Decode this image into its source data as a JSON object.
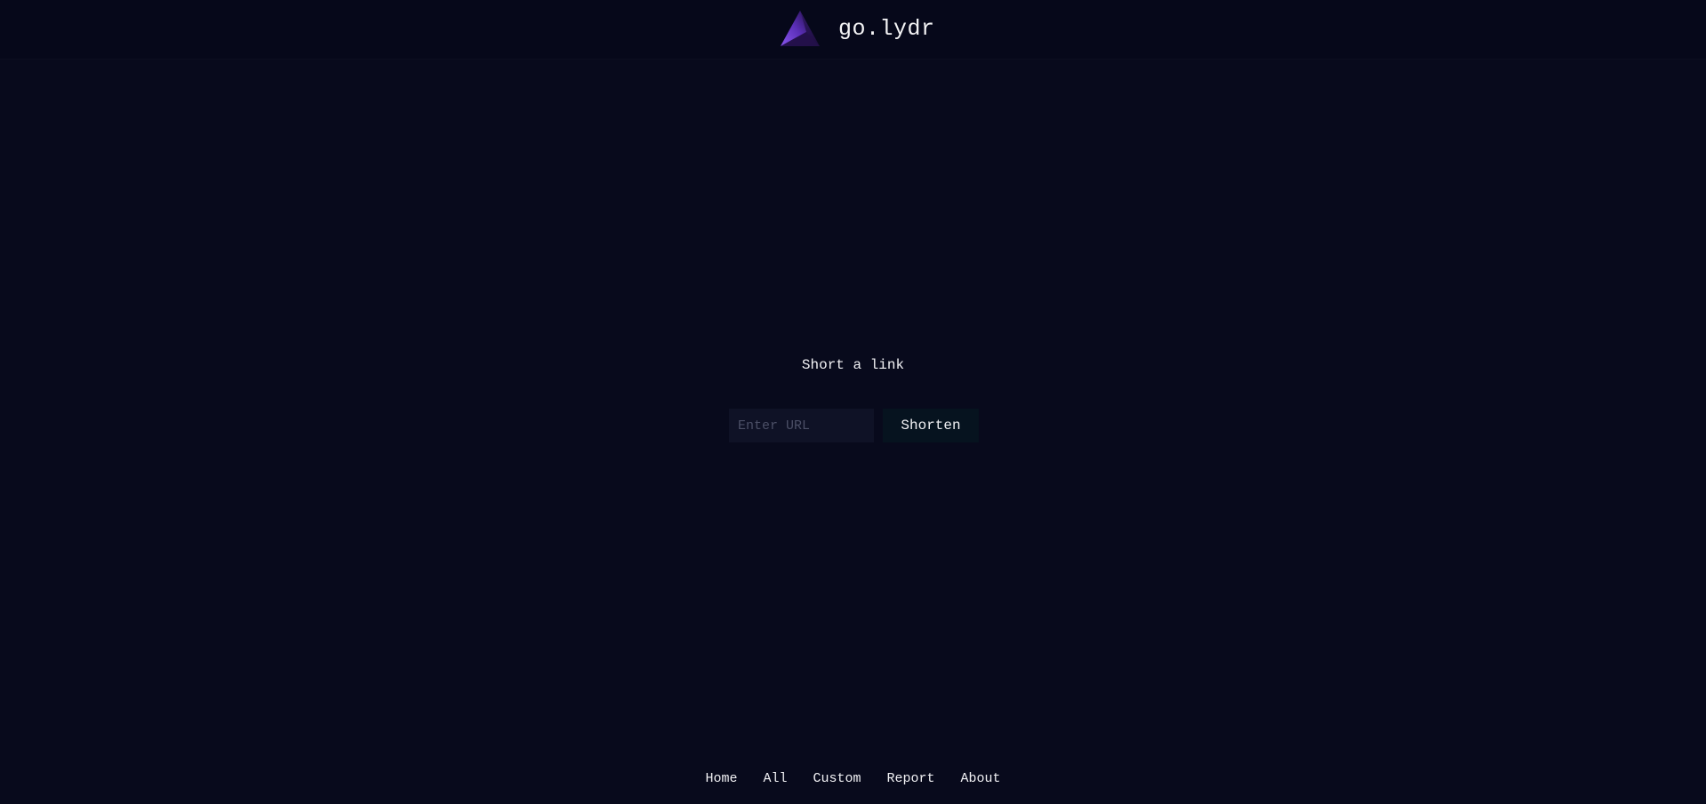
{
  "header": {
    "brand_name": "go.lydr",
    "logo_icon": "triangle-logo-icon"
  },
  "main": {
    "heading": "Short a link",
    "url_input": {
      "value": "",
      "placeholder": "Enter URL"
    },
    "shorten_label": "Shorten"
  },
  "footer": {
    "nav": [
      {
        "label": "Home"
      },
      {
        "label": "All"
      },
      {
        "label": "Custom"
      },
      {
        "label": "Report"
      },
      {
        "label": "About"
      }
    ]
  },
  "colors": {
    "background": "#080a1c",
    "header_background": "#06081a",
    "input_background": "#0f1226",
    "button_background": "#06131f",
    "logo_accent": "#7b45e0"
  }
}
